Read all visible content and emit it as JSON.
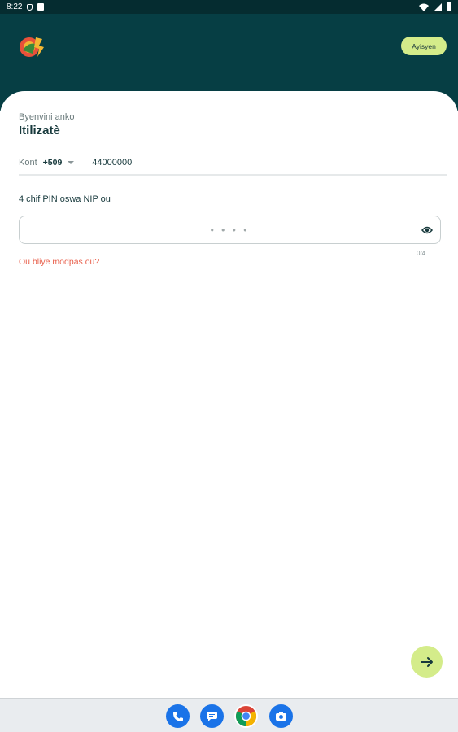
{
  "status_bar": {
    "time": "8:22"
  },
  "header": {
    "button_label": "Ayisyen"
  },
  "login": {
    "welcome_text": "Byenvini anko",
    "user_title": "Itilizatè",
    "account_label": "Kont",
    "country_code": "+509",
    "phone_value": "44000000",
    "pin_label": "4 chif PIN oswa NIP ou",
    "pin_placeholder": "• • • •",
    "pin_counter": "0/4",
    "forgot_link": "Ou bliye modpas ou?"
  },
  "colors": {
    "header_bg": "#063e44",
    "accent": "#d4ec8a",
    "link": "#e8604c"
  },
  "dock": [
    "phone-icon",
    "messages-icon",
    "chrome-icon",
    "camera-icon"
  ]
}
